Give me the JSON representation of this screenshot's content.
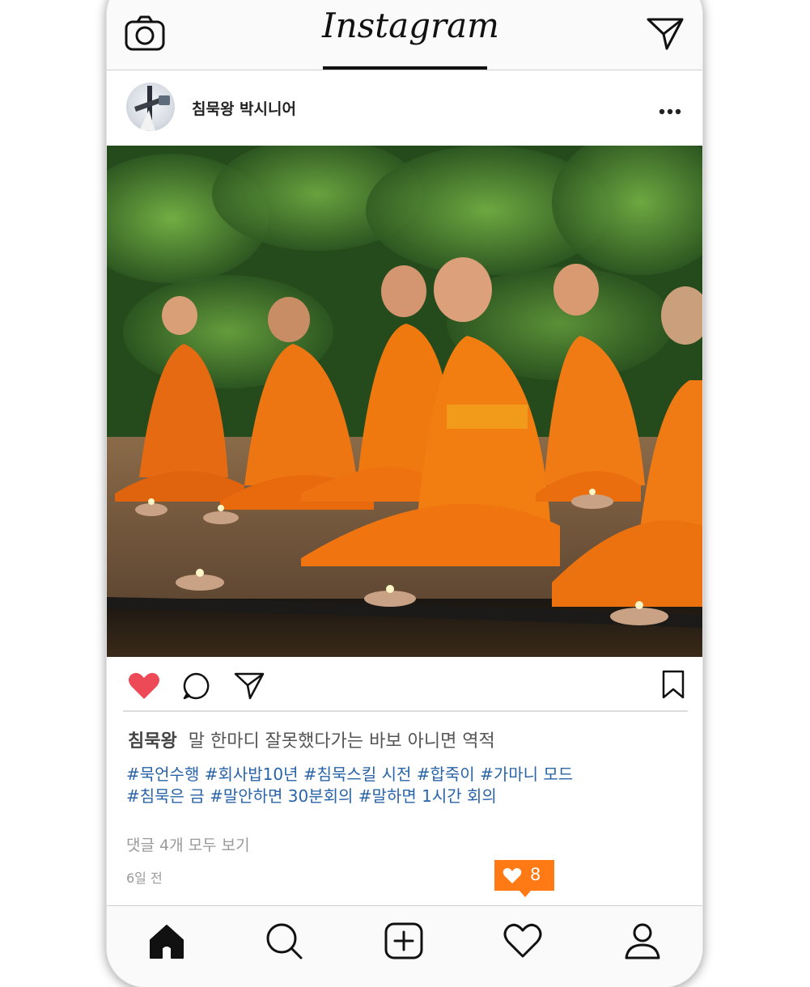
{
  "app": {
    "logo_text": "Instagram"
  },
  "topbar": {
    "icons": [
      "camera-icon",
      "send-icon"
    ]
  },
  "post": {
    "username": "침묵왕 박시니어",
    "caption_user": "침묵왕",
    "caption_text": "말 한마디 잘못했다가는 바보 아니면 역적",
    "hashtags_line1": "#묵언수행 #회사밥10년 #침묵스킬 시전 #합죽이 #가마니 모드",
    "hashtags_line2": "#침묵은 금 #말안하면 30분회의 #말하면 1시간 회의",
    "view_comments": "댓글 4개 모두 보기",
    "time_ago": "6일 전",
    "liked": true,
    "icons": [
      "heart-icon",
      "comment-icon",
      "share-icon",
      "bookmark-icon"
    ]
  },
  "notification": {
    "like_count": "8",
    "color": "#ff7a14"
  },
  "bottom_nav": {
    "items": [
      "home-icon",
      "search-icon",
      "add-post-icon",
      "activity-heart-icon",
      "profile-icon"
    ]
  },
  "colors": {
    "like_red": "#ed4956",
    "hashtag_blue": "#2a64a8",
    "accent_orange": "#ff7a14"
  }
}
